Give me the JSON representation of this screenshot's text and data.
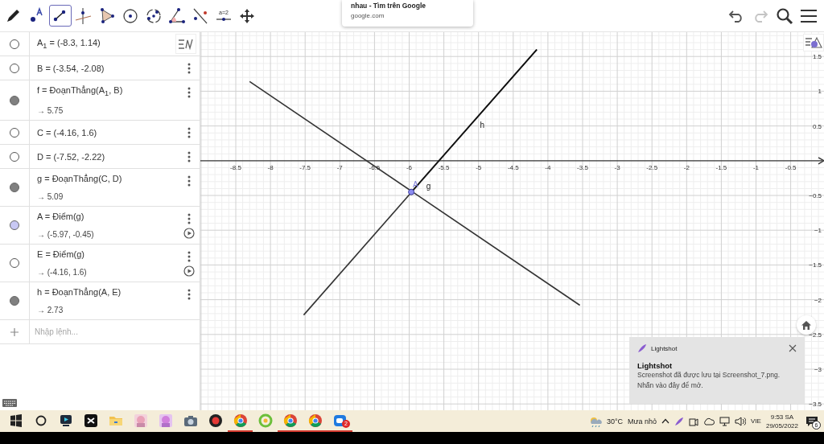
{
  "toolbar": {
    "tools": [
      {
        "kind": "pencil",
        "selected": false
      },
      {
        "kind": "point",
        "selected": false
      },
      {
        "kind": "segment",
        "selected": true
      },
      {
        "kind": "perpendicular",
        "selected": false
      },
      {
        "kind": "polygon",
        "selected": false
      },
      {
        "kind": "circle-center",
        "selected": false
      },
      {
        "kind": "circle-three",
        "selected": false
      },
      {
        "kind": "angle",
        "selected": false
      },
      {
        "kind": "reflect",
        "selected": false
      },
      {
        "kind": "slider",
        "selected": false,
        "label": "a=2"
      },
      {
        "kind": "move",
        "selected": false
      }
    ],
    "undo": {
      "disabled": false
    },
    "redo": {
      "disabled": true
    }
  },
  "browser_tooltip": {
    "title": "nhau - Tìm trên Google",
    "url": "google.com"
  },
  "algebra": {
    "items": [
      {
        "definition": "A$_{1}$ = (-8.3, 1.14)",
        "visible": false,
        "menu": false,
        "play_button": false
      },
      {
        "definition": "B = (-3.54, -2.08)",
        "visible": false,
        "menu": true,
        "play_button": false
      },
      {
        "definition": "f = ĐoạnThẳng(A$_{1}$, B)",
        "value": "→ 5.75",
        "visible": true,
        "color": "#808080",
        "menu": true,
        "play_button": false
      },
      {
        "definition": "C = (-4.16, 1.6)",
        "visible": false,
        "menu": true,
        "play_button": false
      },
      {
        "definition": "D = (-7.52, -2.22)",
        "visible": false,
        "menu": true,
        "play_button": false
      },
      {
        "definition": "g = ĐoạnThẳng(C, D)",
        "value": "→ 5.09",
        "visible": true,
        "color": "#808080",
        "menu": true,
        "play_button": false
      },
      {
        "definition": "A = Điểm(g)",
        "value": "→ (-5.97, -0.45)",
        "visible": true,
        "color": "#c8c8f4",
        "menu": true,
        "play_button": true
      },
      {
        "definition": "E = Điểm(g)",
        "value": "→ (-4.16, 1.6)",
        "visible": false,
        "menu": true,
        "play_button": true
      },
      {
        "definition": "h = ĐoạnThẳng(A, E)",
        "value": "→ 2.73",
        "visible": true,
        "color": "#808080",
        "menu": true,
        "play_button": false
      }
    ],
    "input": {
      "placeholder": "Nhập lệnh..."
    }
  },
  "graphics": {
    "chart_data": {
      "type": "line",
      "grid": true,
      "xlim": [
        -9.01,
        -0.02
      ],
      "ylim": [
        -3.59,
        1.85
      ],
      "xticks": [
        -8.5,
        -8,
        -7.5,
        -7,
        -6.5,
        -6,
        -5.5,
        -5,
        -4.5,
        -4,
        -3.5,
        -3,
        -2.5,
        -2,
        -1.5,
        -1,
        -0.5
      ],
      "yticks": [
        {
          "value": 1.5,
          "label": "1.5"
        },
        {
          "value": 1,
          "label": "1"
        },
        {
          "value": 0.5,
          "label": "0.5"
        },
        {
          "value": -0.5,
          "label": "−0.5"
        },
        {
          "value": -1,
          "label": "−1"
        },
        {
          "value": -1.5,
          "label": "−1.5"
        },
        {
          "value": -2,
          "label": "−2"
        },
        {
          "value": -2.5,
          "label": "−2.5"
        },
        {
          "value": -3,
          "label": "−3"
        },
        {
          "value": -3.5,
          "label": "−3.5"
        }
      ],
      "series": [
        {
          "color": "#333333",
          "x": [
            -8.3,
            -3.54
          ],
          "values": [
            1.14,
            -2.08
          ]
        },
        {
          "name": "g",
          "color": "#333333",
          "x": [
            -4.16,
            -7.52
          ],
          "values": [
            1.6,
            -2.22
          ]
        },
        {
          "name": "h",
          "color": "#111111",
          "x": [
            -5.97,
            -4.16
          ],
          "values": [
            -0.45,
            1.6
          ]
        },
        {
          "name": "A",
          "color": "#8c8cf0",
          "marker": true,
          "x": [
            -5.97
          ],
          "values": [
            -0.45
          ]
        }
      ]
    }
  },
  "notification": {
    "app": "Lightshot",
    "title": "Lightshot",
    "lines": [
      "Screenshot đã được lưu tại Screenshot_7.png.",
      "Nhấn vào đây để mở."
    ]
  },
  "taskbar": {
    "apps": [
      {
        "kind": "start",
        "running": false
      },
      {
        "kind": "search",
        "running": false
      },
      {
        "kind": "tv",
        "running": false
      },
      {
        "kind": "capcut",
        "running": false
      },
      {
        "kind": "folder",
        "running": false
      },
      {
        "kind": "photo",
        "running": false
      },
      {
        "kind": "photo2",
        "running": false
      },
      {
        "kind": "camera",
        "running": false
      },
      {
        "kind": "record",
        "running": false
      },
      {
        "kind": "chrome",
        "running": true
      },
      {
        "kind": "ring",
        "running": false
      },
      {
        "kind": "chrome",
        "running": true
      },
      {
        "kind": "chrome",
        "running": true
      },
      {
        "kind": "messenger",
        "running": true,
        "badge": "2"
      }
    ],
    "weather": {
      "temp": "30°C",
      "text": "Mưa nhỏ"
    },
    "language": "VIE",
    "time": "9:53 SA",
    "date": "29/05/2022",
    "notifications": "6"
  }
}
